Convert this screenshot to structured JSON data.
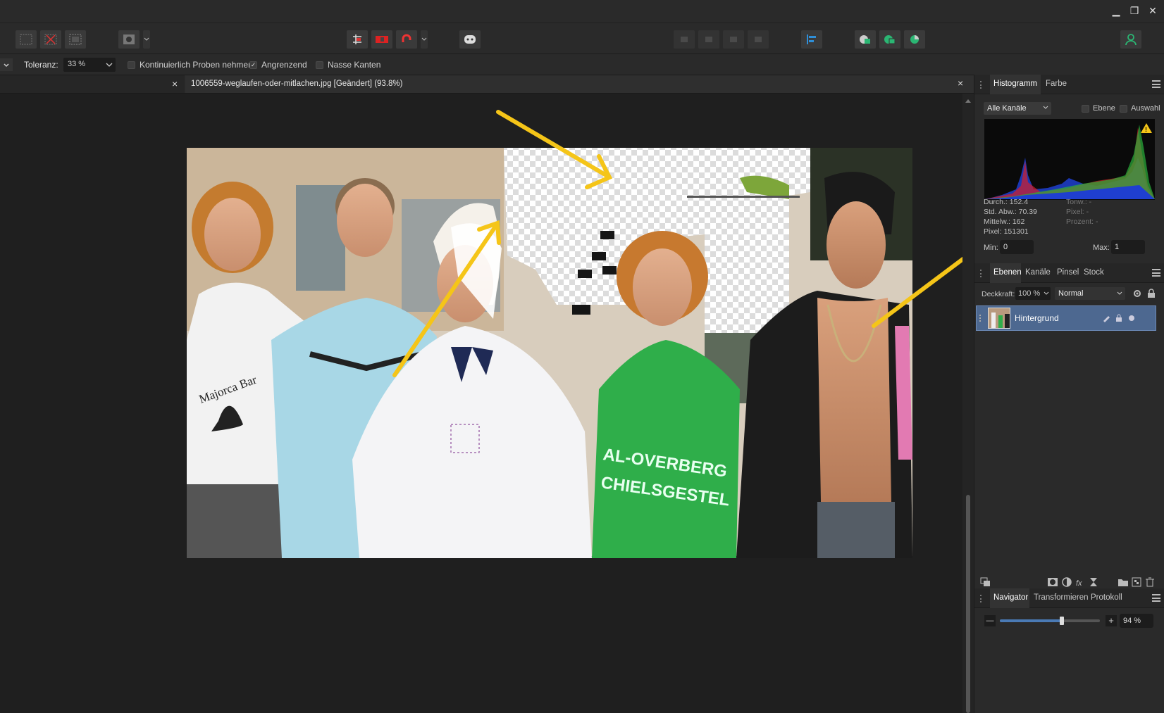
{
  "window": {
    "minimize": "▁",
    "restore": "❐",
    "close": "✕"
  },
  "context": {
    "tolerance_label": "Toleranz:",
    "tolerance_value": "33 %",
    "sample_continuous": "Kontinuierlich Proben nehmen",
    "contiguous": "Angrenzend",
    "contiguous_checked": "✓",
    "wet_edges": "Nasse Kanten"
  },
  "document": {
    "tab_title": "1006559-weglaufen-oder-mitlachen.jpg [Geändert] (93.8%)",
    "close_left": "×",
    "close_right": "×",
    "photo_text_majorca": "Majorca Bar",
    "photo_text_jersey1": "AL-OVERBERG",
    "photo_text_jersey2": "CHIELSGESTEL"
  },
  "histogram": {
    "tab_histogram": "Histogramm",
    "tab_color": "Farbe",
    "channel": "Alle Kanäle",
    "opt_layer": "Ebene",
    "opt_selection": "Auswahl",
    "mean": "Durch.: 152.4",
    "stddev": "Std. Abw.: 70.39",
    "median": "Mittelw.: 162",
    "pixels": "Pixel: 151301",
    "tone": "Tonw.: -",
    "pixel_r": "Pixel: -",
    "percent": "Prozent: -",
    "min_label": "Min:",
    "min_value": "0",
    "max_label": "Max:",
    "max_value": "1",
    "warning": "!"
  },
  "layers": {
    "tab_layers": "Ebenen",
    "tab_channels": "Kanäle",
    "tab_brushes": "Pinsel",
    "tab_stock": "Stock",
    "opacity_label": "Deckkraft:",
    "opacity_value": "100 %",
    "blend_mode": "Normal",
    "layer_name": "Hintergrund"
  },
  "navigator": {
    "tab_navigator": "Navigator",
    "tab_transform": "Transformieren",
    "tab_history": "Protokoll",
    "zoom_minus": "—",
    "zoom_plus": "+",
    "zoom_value": "94 %",
    "zoom_level": 0.62
  },
  "colors": {
    "accent": "#4a7ab5",
    "layer_selected": "#4d6890",
    "arrow": "#f5c518",
    "hist_red": "#d61f2a",
    "hist_green": "#29b03a",
    "hist_blue": "#1f3fd0"
  }
}
